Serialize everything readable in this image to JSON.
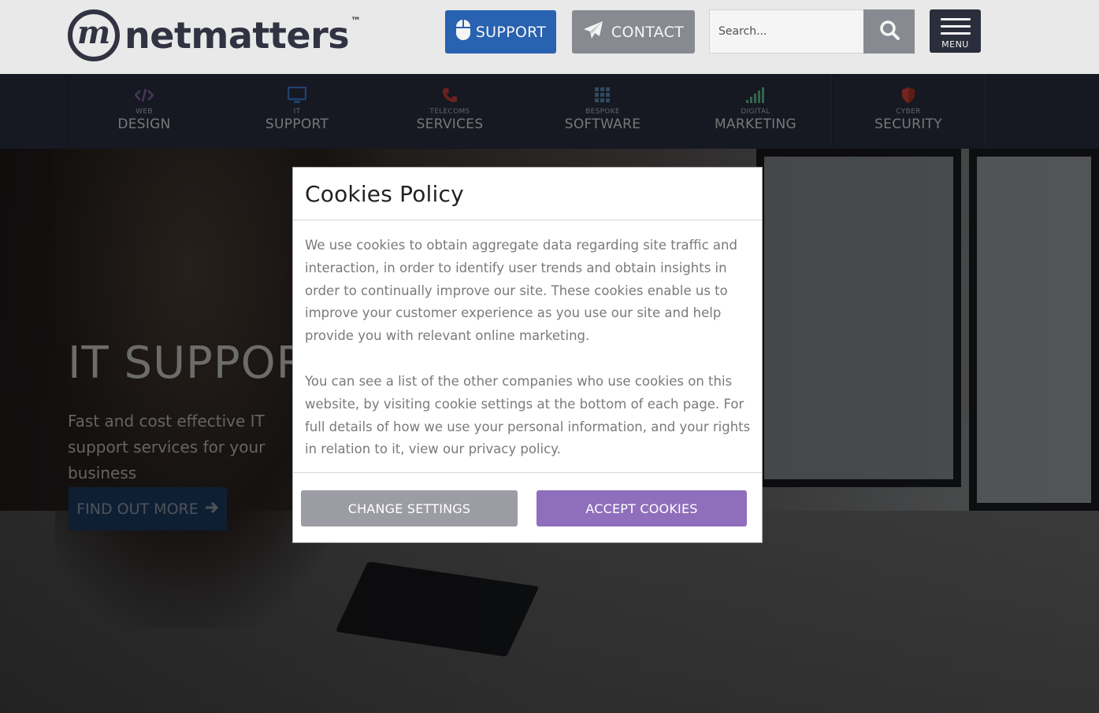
{
  "header": {
    "logo_letter": "m",
    "logo_text": "netmatters",
    "logo_tm": "™",
    "support_label": "SUPPORT",
    "contact_label": "CONTACT",
    "search_placeholder": "Search...",
    "menu_label": "MENU",
    "colors": {
      "support": "#2a66b8",
      "contact": "#8e9097",
      "menu": "#2c2f3d"
    }
  },
  "nav": {
    "items": [
      {
        "sub": "WEB",
        "main": "DESIGN",
        "icon": "code-icon",
        "color": "#926fb1"
      },
      {
        "sub": "IT",
        "main": "SUPPORT",
        "icon": "monitor-icon",
        "color": "#4183d7"
      },
      {
        "sub": "TELECOMS",
        "main": "SERVICES",
        "icon": "phone-icon",
        "color": "#d64541"
      },
      {
        "sub": "BESPOKE",
        "main": "SOFTWARE",
        "icon": "grid-icon",
        "color": "#5c97bf"
      },
      {
        "sub": "DIGITAL",
        "main": "MARKETING",
        "icon": "signal-bars-icon",
        "color": "#66cc99"
      },
      {
        "sub": "CYBER",
        "main": "SECURITY",
        "icon": "shield-icon",
        "color": "#e94b3c"
      }
    ]
  },
  "hero": {
    "title": "IT SUPPORT",
    "subtitle": "Fast and cost effective IT support services for your business",
    "cta_label": "FIND OUT MORE",
    "slides_count": 6,
    "active_slide": 2
  },
  "modal": {
    "title": "Cookies Policy",
    "paragraph1": "We use cookies to obtain aggregate data regarding site traffic and interaction, in order to identify user trends and obtain insights in order to continually improve our site. These cookies enable us to improve your customer experience as you use our site and help provide you with relevant online marketing.",
    "paragraph2": "You can see a list of the other companies who use cookies on this website, by visiting cookie settings at the bottom of each page. For full details of how we use your personal information, and your rights in relation to it, view our privacy policy.",
    "change_settings_label": "CHANGE SETTINGS",
    "accept_label": "ACCEPT COOKIES",
    "colors": {
      "accept": "#8f6fbb",
      "change": "#9c9da4"
    }
  }
}
